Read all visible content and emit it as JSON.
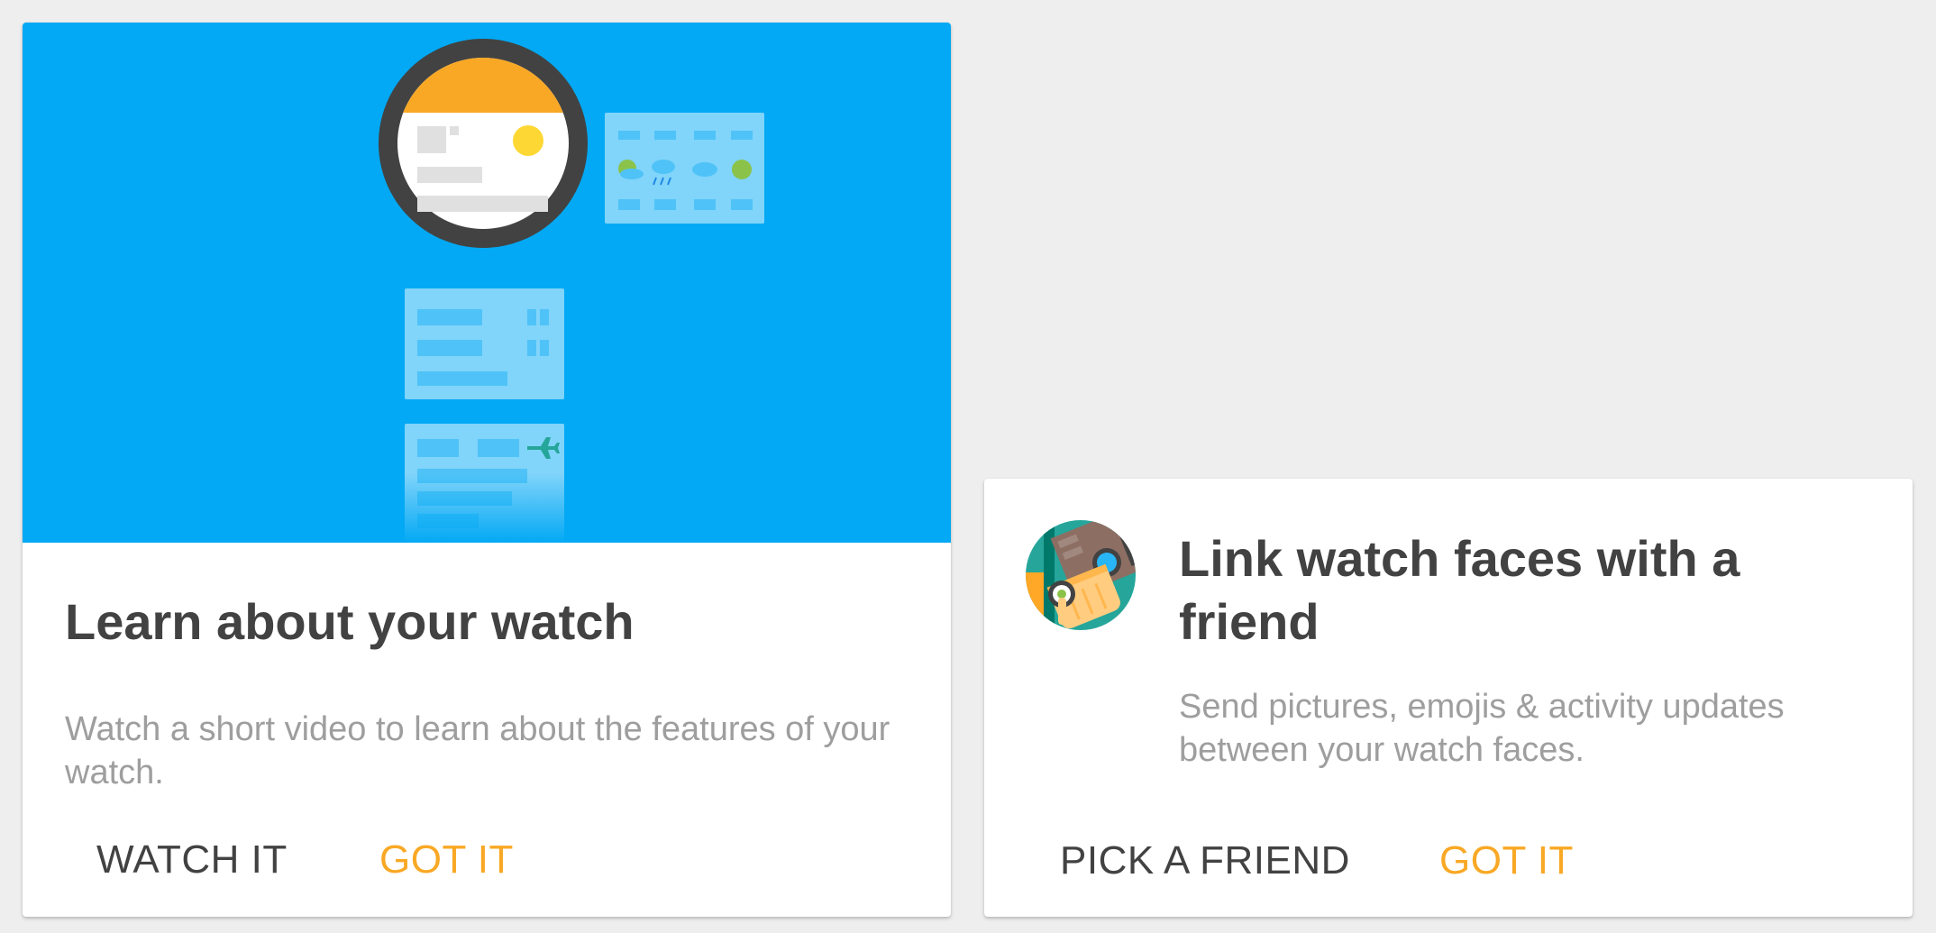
{
  "learn_card": {
    "title": "Learn about your watch",
    "description": "Watch a short video to learn about the features of your watch.",
    "primary_action": "WATCH IT",
    "dismiss_action": "GOT IT",
    "illustration": "watch-with-notification-cards-illustration"
  },
  "link_card": {
    "title": "Link watch faces with a friend",
    "description": "Send pictures, emojis & activity updates between your watch faces.",
    "primary_action": "PICK A FRIEND",
    "dismiss_action": "GOT IT",
    "icon": "hand-touching-watch-icon"
  },
  "colors": {
    "background": "#eeeeee",
    "card": "#ffffff",
    "hero": "#03a9f4",
    "title_text": "#424242",
    "body_text": "#9e9e9e",
    "accent": "#f9a825"
  }
}
